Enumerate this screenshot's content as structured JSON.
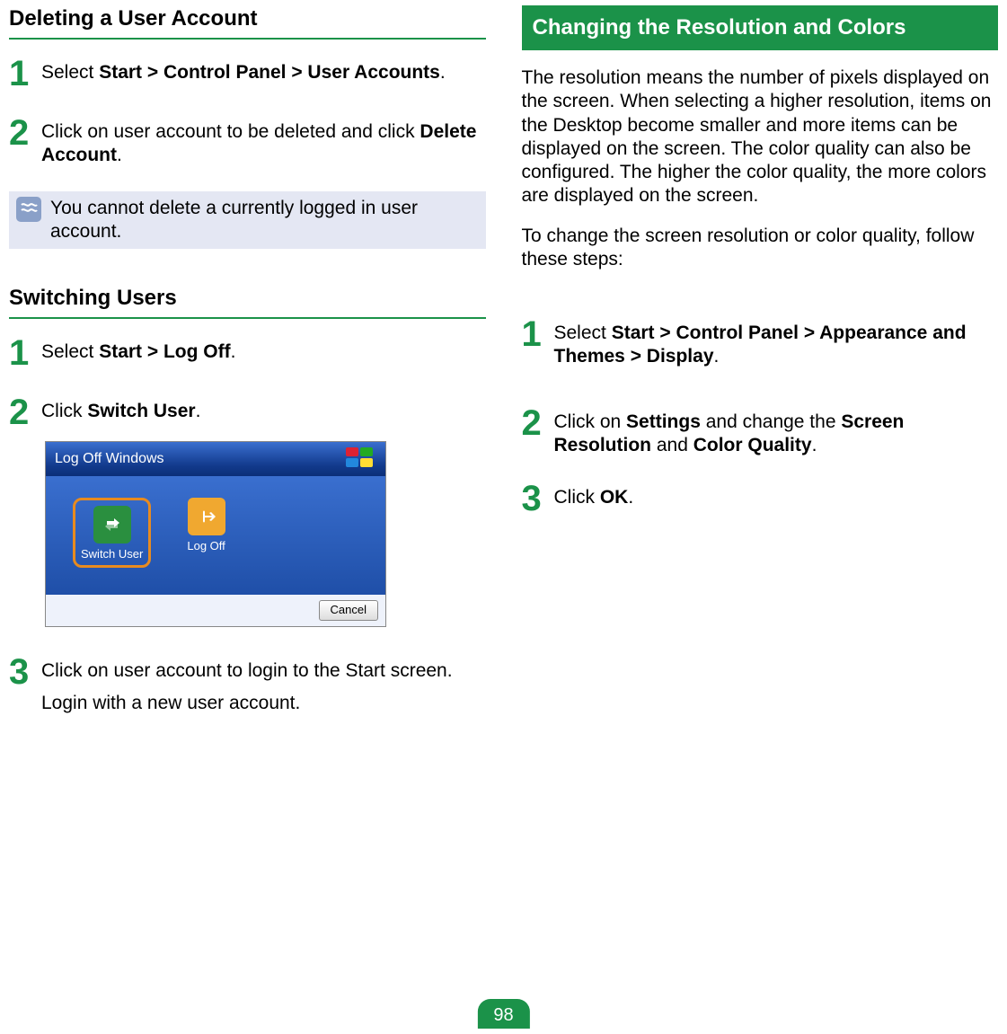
{
  "left": {
    "section1": {
      "heading": "Deleting a User Account",
      "step1": {
        "num": "1",
        "pre": "Select ",
        "bold": "Start > Control Panel > User Accounts",
        "post": "."
      },
      "step2": {
        "num": "2",
        "text_a": "Click on user account to be deleted and click ",
        "bold": "Delete Account",
        "text_b": "."
      },
      "note": "You cannot delete a currently logged in user account."
    },
    "section2": {
      "heading": "Switching Users",
      "step1": {
        "num": "1",
        "pre": "Select ",
        "bold": "Start > Log Off",
        "post": "."
      },
      "step2": {
        "num": "2",
        "pre": "Click ",
        "bold": "Switch User",
        "post": "."
      },
      "dialog": {
        "title": "Log Off Windows",
        "switch_label": "Switch User",
        "logoff_label": "Log Off",
        "cancel": "Cancel"
      },
      "step3": {
        "num": "3",
        "text": "Click on user account to login to the Start screen.",
        "sub": "Login with a new user account."
      }
    }
  },
  "right": {
    "heading": "Changing the Resolution and Colors",
    "para1": "The resolution means the number of pixels displayed on the screen. When selecting a higher resolution, items on the Desktop become smaller and more items can be displayed on the screen. The color quality can also be configured. The higher the color quality, the more colors are displayed on the screen.",
    "para2": "To change the screen resolution or color quality, follow these steps:",
    "step1": {
      "num": "1",
      "pre": "Select ",
      "bold": "Start > Control Panel > Appearance and Themes > Display",
      "post": "."
    },
    "step2": {
      "num": "2",
      "pre": "Click on ",
      "b1": "Settings",
      "mid": " and change the ",
      "b2": "Screen Resolution",
      "mid2": " and ",
      "b3": "Color Quality",
      "post": "."
    },
    "step3": {
      "num": "3",
      "pre": "Click ",
      "bold": "OK",
      "post": "."
    }
  },
  "page_number": "98"
}
